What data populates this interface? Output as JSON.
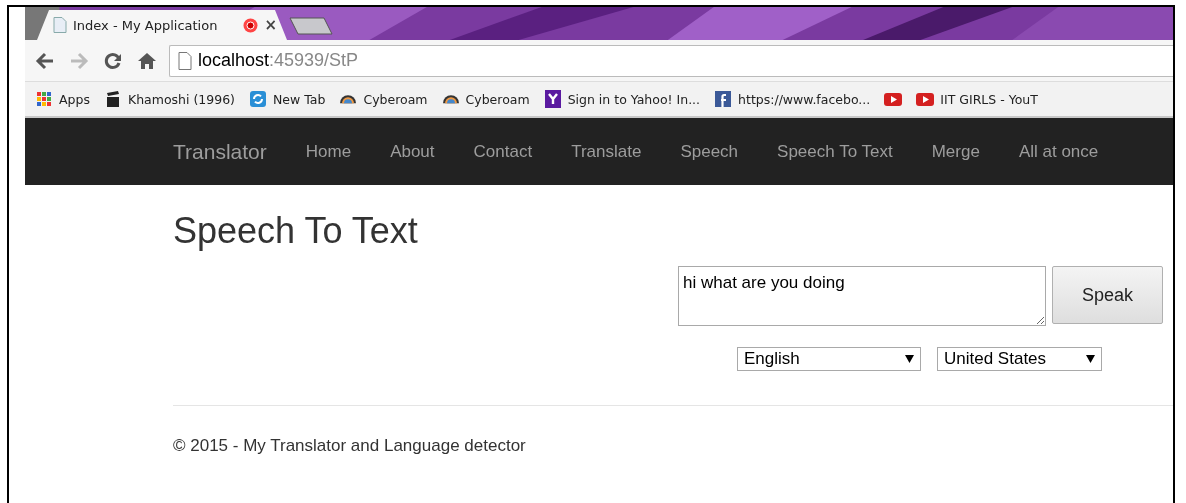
{
  "browser": {
    "tabs": [
      {
        "title": "Index - My Application",
        "recording": true,
        "close": "×",
        "selected": true
      }
    ],
    "toolbar": {
      "back_disabled": false,
      "forward_disabled": true,
      "url_host": "localhost",
      "url_rest": ":45939/StP"
    },
    "bookmarks": [
      {
        "kind": "apps",
        "label": "Apps"
      },
      {
        "kind": "clapper",
        "label": "Khamoshi (1996)"
      },
      {
        "kind": "newtab",
        "label": "New Tab"
      },
      {
        "kind": "rainbow",
        "label": "Cyberoam"
      },
      {
        "kind": "rainbow",
        "label": "Cyberoam"
      },
      {
        "kind": "yahoo",
        "label": "Sign in to Yahoo! In..."
      },
      {
        "kind": "facebook",
        "label": "https://www.facebo..."
      },
      {
        "kind": "youtube"
      },
      {
        "kind": "youtube",
        "label": "IIT GIRLS - YouT"
      }
    ]
  },
  "navbar": {
    "brand": "Translator",
    "links": [
      "Home",
      "About",
      "Contact",
      "Translate",
      "Speech",
      "Speech To Text",
      "Merge",
      "All at once"
    ]
  },
  "page": {
    "title": "Speech To Text",
    "speech_text": "hi what are you doing",
    "speak_button": "Speak",
    "language": "English",
    "region": "United States",
    "footer": "© 2015 - My Translator and Language detector"
  }
}
